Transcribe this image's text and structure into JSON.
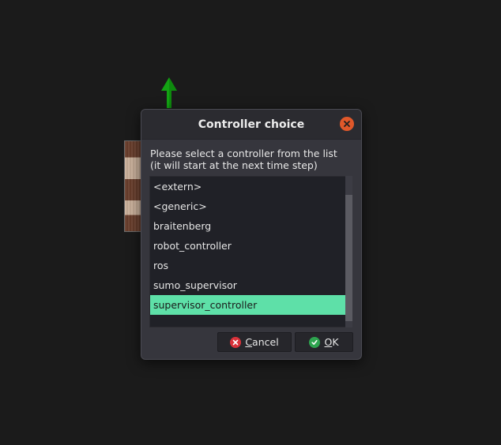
{
  "dialog": {
    "title": "Controller choice",
    "message_line1": "Please select a controller from the list",
    "message_line2": "(it will start at the next time step)"
  },
  "controllers": [
    "<extern>",
    "<generic>",
    "braitenberg",
    "robot_controller",
    "ros",
    "sumo_supervisor",
    "supervisor_controller"
  ],
  "selected_controller": "supervisor_controller",
  "buttons": {
    "cancel_mnemonic": "C",
    "cancel_rest": "ancel",
    "ok_mnemonic": "O",
    "ok_rest": "K"
  },
  "colors": {
    "selection": "#5ee0a8",
    "close": "#e0582a",
    "cancel_icon": "#d9323a",
    "ok_icon": "#2ea44f",
    "arrow": "#13a313"
  },
  "icons": {
    "close": "close-icon",
    "cancel": "cancel-icon",
    "ok": "check-icon",
    "scene_arrow": "up-arrow-icon"
  }
}
